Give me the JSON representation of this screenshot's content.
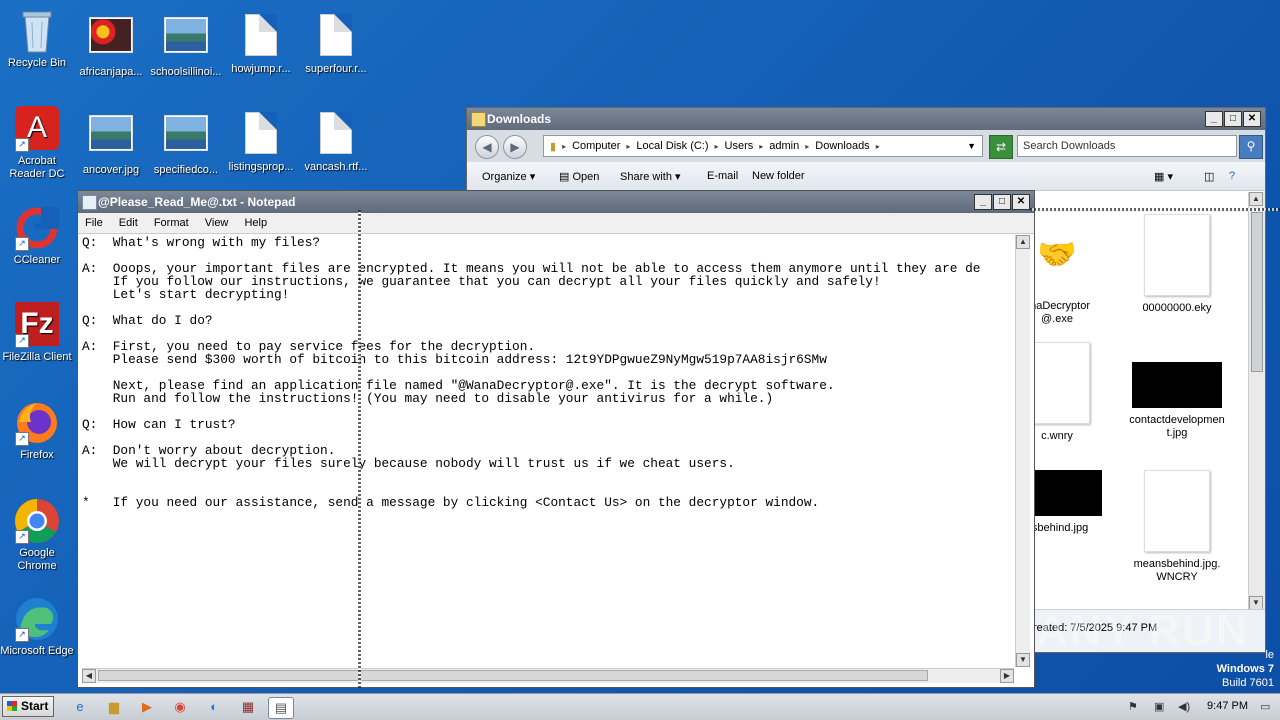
{
  "desktop": {
    "icons": [
      {
        "label": "Recycle Bin",
        "icon": "recycle-bin-icon"
      },
      {
        "label": "africanjapa...",
        "icon": "image-icon"
      },
      {
        "label": "schoolsillinoi...",
        "icon": "image-icon"
      },
      {
        "label": "howjump.r...",
        "icon": "document-icon"
      },
      {
        "label": "superfour.r...",
        "icon": "document-icon"
      },
      {
        "label": "Acrobat Reader DC",
        "icon": "acrobat-icon"
      },
      {
        "label": "ancover.jpg",
        "icon": "image-icon"
      },
      {
        "label": "specifiedco...",
        "icon": "image-icon"
      },
      {
        "label": "listingsprop...",
        "icon": "document-icon"
      },
      {
        "label": "vancash.rtf...",
        "icon": "document-icon"
      },
      {
        "label": "CCleaner",
        "icon": "ccleaner-icon"
      },
      {
        "label": "FileZilla Client",
        "icon": "filezilla-icon"
      },
      {
        "label": "Firefox",
        "icon": "firefox-icon"
      },
      {
        "label": "Google Chrome",
        "icon": "chrome-icon"
      },
      {
        "label": "Microsoft Edge",
        "icon": "edge-icon"
      }
    ]
  },
  "explorer": {
    "title": "Downloads",
    "breadcrumb": [
      "Computer",
      "Local Disk (C:)",
      "Users",
      "admin",
      "Downloads"
    ],
    "search_placeholder": "Search Downloads",
    "toolbar": {
      "organize": "Organize",
      "open": "Open",
      "share_with": "Share with",
      "email": "E-mail",
      "new_folder": "New folder"
    },
    "files": [
      {
        "name": "anaDecryptor @.exe"
      },
      {
        "name": "00000000.eky"
      },
      {
        "name": "c.wnry"
      },
      {
        "name": "contactdevelopmen t.jpg"
      },
      {
        "name": "nsbehind.jpg"
      },
      {
        "name": "meansbehind.jpg. WNCRY"
      }
    ],
    "status": "reated: 7/5/2025 9:47 PM"
  },
  "notepad": {
    "title": "@Please_Read_Me@.txt - Notepad",
    "menu": [
      "File",
      "Edit",
      "Format",
      "View",
      "Help"
    ],
    "content": "Q:  What's wrong with my files?\n\nA:  Ooops, your important files are encrypted. It means you will not be able to access them anymore until they are de\n    If you follow our instructions, we guarantee that you can decrypt all your files quickly and safely!\n    Let's start decrypting!\n\nQ:  What do I do?\n\nA:  First, you need to pay service fees for the decryption.\n    Please send $300 worth of bitcoin to this bitcoin address: 12t9YDPgwueZ9NyMgw519p7AA8isjr6SMw\n\n    Next, please find an application file named \"@WanaDecryptor@.exe\". It is the decrypt software.\n    Run and follow the instructions! (You may need to disable your antivirus for a while.)\n\nQ:  How can I trust?\n\nA:  Don't worry about decryption.\n    We will decrypt your files surely because nobody will trust us if we cheat users.\n\n\n*   If you need our assistance, send a message by clicking <Contact Us> on the decryptor window."
  },
  "watermark": "ANY RUN",
  "os_info": {
    "line1": "Windows 7",
    "line2": "Build 7601",
    "partial": "le"
  },
  "taskbar": {
    "start_label": "Start",
    "clock": "9:47 PM"
  }
}
